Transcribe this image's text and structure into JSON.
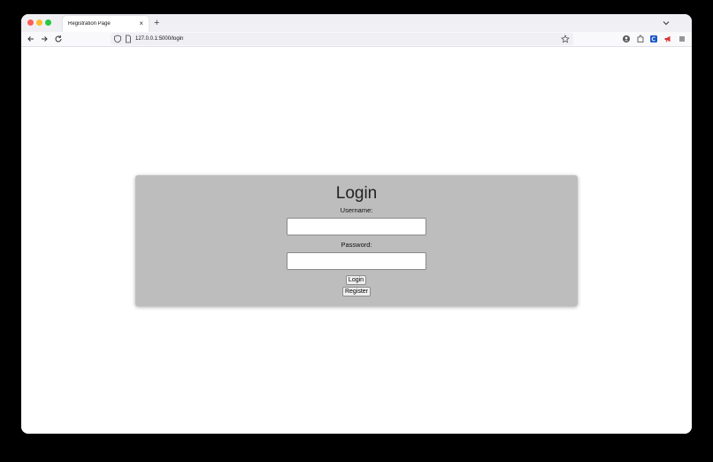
{
  "browser": {
    "tab_title": "Registration Page",
    "tab_close": "×",
    "new_tab": "+",
    "url": "127.0.0.1:5000/login"
  },
  "login": {
    "title": "Login",
    "username_label": "Username:",
    "username_value": "",
    "password_label": "Password:",
    "password_value": "",
    "login_button": "Login",
    "register_button": "Register"
  },
  "colors": {
    "card_bg": "#bebdbd",
    "tab_bar_bg": "#f0f0f4",
    "desktop_bg": "#000000"
  }
}
